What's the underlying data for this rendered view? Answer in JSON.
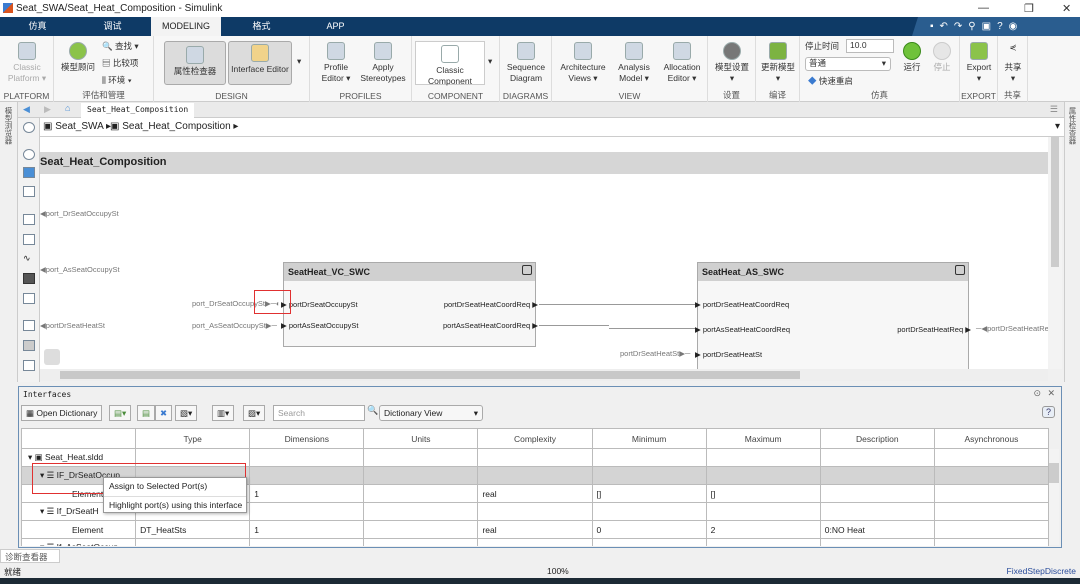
{
  "window": {
    "title": "Seat_SWA/Seat_Heat_Composition - Simulink",
    "minimize": "—",
    "restore": "❐",
    "close": "✕"
  },
  "tabs": [
    {
      "label": "仿真"
    },
    {
      "label": "调试"
    },
    {
      "label": "MODELING"
    },
    {
      "label": "格式"
    },
    {
      "label": "APP"
    }
  ],
  "ribbon": {
    "platform": {
      "button": "Classic Platform ▾",
      "label": "PLATFORM"
    },
    "evaluate": {
      "advisor": "模型顾问",
      "find": "查找",
      "compare": "比较项",
      "env": "环境",
      "label": "评估和管理"
    },
    "design": {
      "property_inspector": "属性检查器",
      "interface_editor": "Interface Editor",
      "label": "DESIGN"
    },
    "profiles": {
      "profile_editor": "Profile Editor ▾",
      "apply_stereotypes": "Apply Stereotypes",
      "label": "PROFILES"
    },
    "component": {
      "classic": "Classic Component",
      "label": "COMPONENT"
    },
    "diagrams": {
      "sequence": "Sequence Diagram",
      "label": "DIAGRAMS"
    },
    "view": {
      "arch_views": "Architecture Views ▾",
      "analysis": "Analysis Model ▾",
      "allocation": "Allocation Editor ▾",
      "label": "VIEW"
    },
    "settings": {
      "model_settings": "模型设置",
      "label": "设置"
    },
    "compile": {
      "update": "更新模型",
      "label": "编译"
    },
    "sim": {
      "stop_time_label": "停止时间",
      "stop_time": "10.0",
      "mode": "普通",
      "fast_restart": "快速重启",
      "run": "运行",
      "stop": "停止",
      "label": "仿真"
    },
    "export": {
      "button": "Export",
      "label": "EXPORT"
    },
    "share": {
      "button": "共享",
      "label": "共享"
    }
  },
  "nav": {
    "tab": "Seat_Heat_Composition"
  },
  "breadcrumb": [
    "Seat_SWA",
    "Seat_Heat_Composition"
  ],
  "side_labels": {
    "left": "模型浏览器",
    "right": "属性检查器"
  },
  "canvas": {
    "title": "Seat_Heat_Composition",
    "root_ports": [
      "port_DrSeatOccupySt",
      "port_AsSeatOccupySt",
      "portDrSeatHeatSt"
    ],
    "vc": {
      "name": "SeatHeat_VC_SWC",
      "in": [
        "portDrSeatOccupySt",
        "portAsSeatOccupySt"
      ],
      "out": [
        "portDrSeatHeatCoordReq",
        "portAsSeatHeatCoordReq"
      ],
      "ext_in": [
        "port_DrSeatOccupySt",
        "port_AsSeatOccupySt"
      ]
    },
    "as": {
      "name": "SeatHeat_AS_SWC",
      "in": [
        "portDrSeatHeatCoordReq",
        "portAsSeatHeatCoordReq",
        "portDrSeatHeatSt"
      ],
      "out": [
        "portDrSeatHeatReq"
      ],
      "ext_in": "portDrSeatHeatSt",
      "ext_out": "portDrSeatHeatRe"
    }
  },
  "interfaces": {
    "title": "Interfaces",
    "open_dictionary": "Open Dictionary",
    "search_placeholder": "Search",
    "view_select": "Dictionary View",
    "columns": [
      "",
      "Type",
      "Dimensions",
      "Units",
      "Complexity",
      "Minimum",
      "Maximum",
      "Description",
      "Asynchronous"
    ],
    "rows": [
      [
        "Seat_Heat.sldd",
        "",
        "",
        "",
        "",
        "",
        "",
        "",
        ""
      ],
      [
        "IF_DrSeatOccup",
        "",
        "",
        "",
        "",
        "",
        "",
        "",
        ""
      ],
      [
        "Element",
        "",
        "1",
        "",
        "real",
        "[]",
        "[]",
        "",
        ""
      ],
      [
        "If_DrSeatH",
        "",
        "",
        "",
        "",
        "",
        "",
        "",
        ""
      ],
      [
        "Element",
        "DT_HeatSts",
        "1",
        "",
        "real",
        "0",
        "2",
        "0:NO Heat",
        ""
      ],
      [
        "If_AsSeatOccup",
        "",
        "",
        "",
        "",
        "",
        "",
        "",
        ""
      ]
    ],
    "context_menu": [
      "Assign to Selected Port(s)",
      "Highlight port(s) using this interface"
    ]
  },
  "bottom_tab": "诊断查看器",
  "status": {
    "left": "就绪",
    "zoom": "100%",
    "solver": "FixedStepDiscrete"
  }
}
